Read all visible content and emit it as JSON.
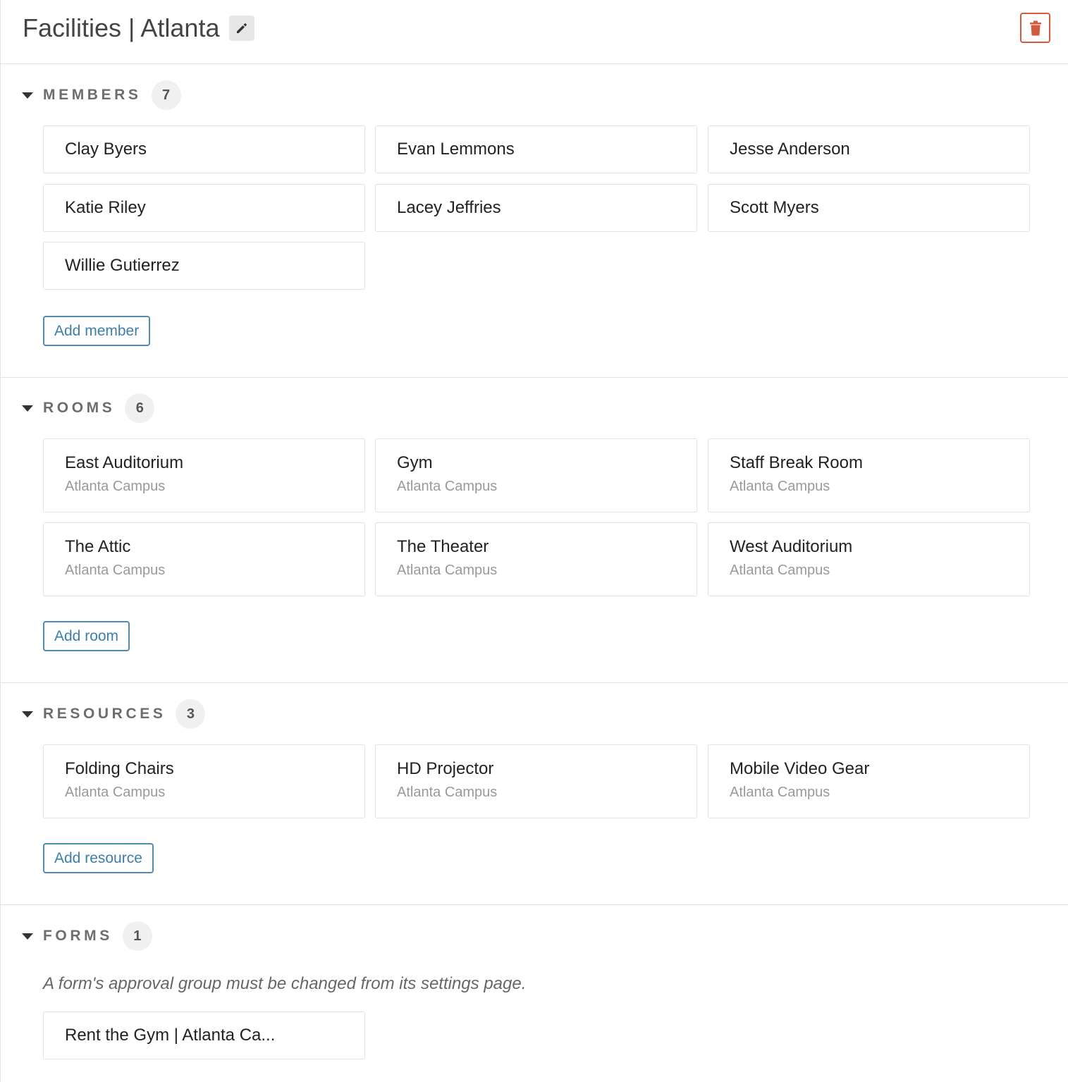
{
  "header": {
    "title": "Facilities | Atlanta",
    "edit_icon": "pencil-icon",
    "delete_icon": "trash-icon",
    "delete_color": "#d45a3d"
  },
  "members": {
    "label": "MEMBERS",
    "count": "7",
    "items": [
      "Clay Byers",
      "Evan Lemmons",
      "Jesse Anderson",
      "Katie Riley",
      "Lacey Jeffries",
      "Scott Myers",
      "Willie Gutierrez"
    ],
    "add_label": "Add member"
  },
  "rooms": {
    "label": "ROOMS",
    "count": "6",
    "items": [
      {
        "name": "East Auditorium",
        "campus": "Atlanta Campus"
      },
      {
        "name": "Gym",
        "campus": "Atlanta Campus"
      },
      {
        "name": "Staff Break Room",
        "campus": "Atlanta Campus"
      },
      {
        "name": "The Attic",
        "campus": "Atlanta Campus"
      },
      {
        "name": "The Theater",
        "campus": "Atlanta Campus"
      },
      {
        "name": "West Auditorium",
        "campus": "Atlanta Campus"
      }
    ],
    "add_label": "Add room"
  },
  "resources": {
    "label": "RESOURCES",
    "count": "3",
    "items": [
      {
        "name": "Folding Chairs",
        "campus": "Atlanta Campus"
      },
      {
        "name": "HD Projector",
        "campus": "Atlanta Campus"
      },
      {
        "name": "Mobile Video Gear",
        "campus": "Atlanta Campus"
      }
    ],
    "add_label": "Add resource"
  },
  "forms": {
    "label": "FORMS",
    "count": "1",
    "note": "A form's approval group must be changed from its settings page.",
    "items": [
      "Rent the Gym | Atlanta Ca..."
    ]
  },
  "colors": {
    "accent": "#3c7fab",
    "danger": "#d45a3d"
  }
}
